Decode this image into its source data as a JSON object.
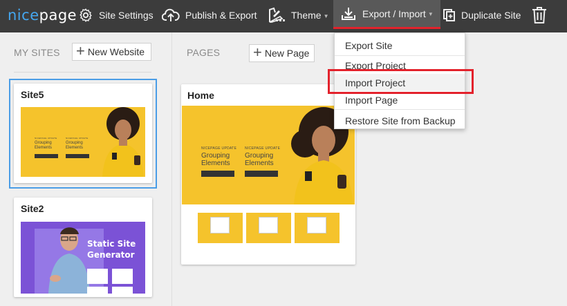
{
  "logo": {
    "part1": "nice",
    "part2": "page"
  },
  "toolbar": {
    "site_settings": "Site Settings",
    "publish_export": "Publish & Export",
    "theme": "Theme",
    "export_import": "Export / Import",
    "duplicate_site": "Duplicate Site"
  },
  "left": {
    "section_label": "MY SITES",
    "new_website": "New Website",
    "sites": [
      {
        "name": "Site5"
      },
      {
        "name": "Site2",
        "heading1": "Static Site",
        "heading2": "Generator"
      }
    ]
  },
  "pages": {
    "section_label": "PAGES",
    "new_page": "New Page",
    "items": [
      {
        "name": "Home"
      }
    ]
  },
  "preview": {
    "grouping1": "Grouping",
    "grouping2": "Elements"
  },
  "dropdown": {
    "items": [
      "Export Site",
      "Export Project",
      "Import Project",
      "Import Page",
      "Restore Site from Backup"
    ]
  },
  "colors": {
    "accent": "#e3222c",
    "brand": "#45a7f0",
    "selected": "#4a9de6"
  }
}
